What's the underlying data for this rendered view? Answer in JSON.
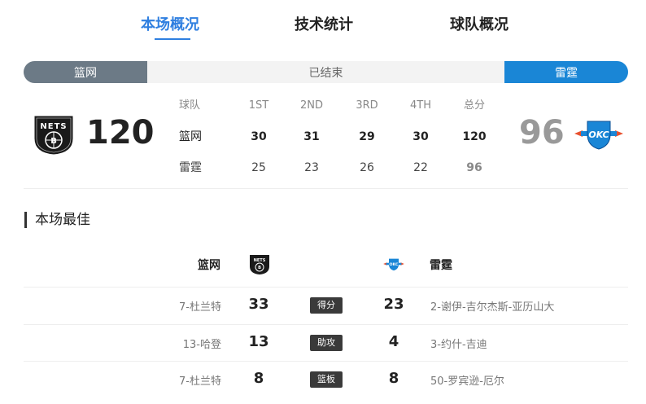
{
  "tabs": [
    {
      "label": "本场概况",
      "active": true
    },
    {
      "label": "技术统计",
      "active": false
    },
    {
      "label": "球队概况",
      "active": false
    }
  ],
  "status": {
    "home_team": "篮网",
    "state": "已结束",
    "away_team": "雷霆"
  },
  "score": {
    "home": {
      "team": "篮网",
      "score": "120",
      "logo_icon": "nets-logo-icon"
    },
    "away": {
      "team": "雷霆",
      "score": "96",
      "logo_icon": "thunder-logo-icon"
    }
  },
  "quarters": {
    "headers": [
      "球队",
      "1ST",
      "2ND",
      "3RD",
      "4TH",
      "总分"
    ],
    "rows": [
      {
        "team": "篮网",
        "q": [
          "30",
          "31",
          "29",
          "30"
        ],
        "total": "120"
      },
      {
        "team": "雷霆",
        "q": [
          "25",
          "23",
          "26",
          "22"
        ],
        "total": "96"
      }
    ]
  },
  "best": {
    "title": "本场最佳",
    "home_team": "篮网",
    "away_team": "雷霆",
    "rows": [
      {
        "home_player": "7-杜兰特",
        "home_value": "33",
        "category": "得分",
        "away_value": "23",
        "away_player": "2-谢伊-吉尔杰斯-亚历山大"
      },
      {
        "home_player": "13-哈登",
        "home_value": "13",
        "category": "助攻",
        "away_value": "4",
        "away_player": "3-约什-吉迪"
      },
      {
        "home_player": "7-杜兰特",
        "home_value": "8",
        "category": "篮板",
        "away_value": "8",
        "away_player": "50-罗宾逊-厄尔"
      }
    ]
  },
  "colors": {
    "accent": "#2f7fe0",
    "home_bar": "#6c7a86",
    "away_bar": "#1a86d6"
  }
}
